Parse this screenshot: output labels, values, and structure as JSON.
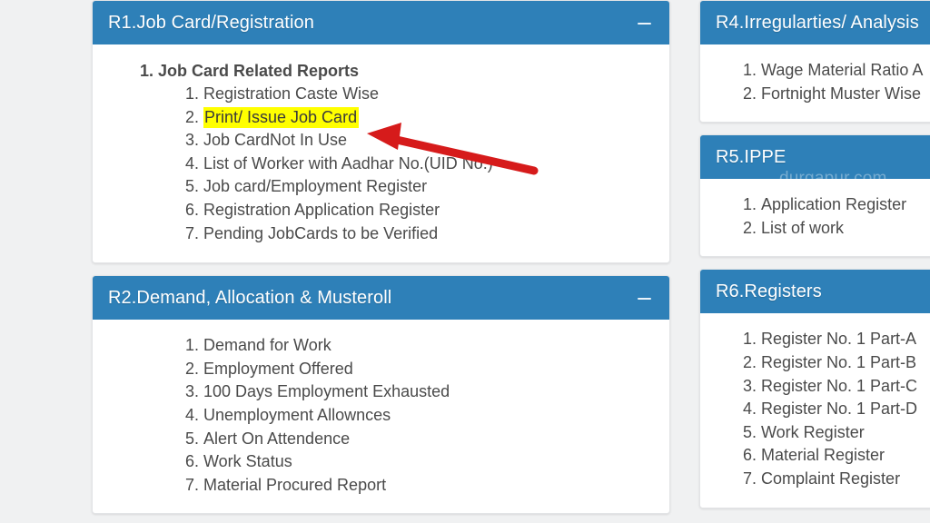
{
  "page": {
    "background_color": "#f0f1f2",
    "panel_header_color": "#2e80b8",
    "highlight_color": "#ffff00",
    "annotation_arrow_color": "#d61b1b"
  },
  "watermark": {
    "text": "durgapur.com"
  },
  "panels": {
    "r1": {
      "title": "R1.Job Card/Registration",
      "collapse_icon": "minus-icon",
      "group_heading": "Job Card Related Reports",
      "items": [
        "Registration Caste Wise",
        "Print/ Issue Job Card",
        "Job CardNot In Use",
        "List of Worker with Aadhar No.(UID No.)",
        "Job card/Employment Register",
        "Registration Application Register",
        "Pending JobCards to be Verified"
      ],
      "highlighted_item_index": 1
    },
    "r2": {
      "title": "R2.Demand, Allocation & Musteroll",
      "collapse_icon": "minus-icon",
      "items": [
        "Demand for Work",
        "Employment Offered",
        "100 Days Employment Exhausted",
        "Unemployment Allownces",
        "Alert On Attendence",
        "Work Status",
        "Material Procured Report"
      ]
    },
    "r4": {
      "title": "R4.Irregularties/ Analysis",
      "items": [
        "Wage Material Ratio A",
        "Fortnight Muster Wise"
      ]
    },
    "r5": {
      "title": "R5.IPPE",
      "items": [
        "Application Register",
        "List of work"
      ]
    },
    "r6": {
      "title": "R6.Registers",
      "items": [
        "Register No. 1 Part-A",
        "Register No. 1 Part-B",
        "Register No. 1 Part-C",
        "Register No. 1 Part-D",
        "Work Register",
        "Material Register",
        "Complaint Register"
      ]
    }
  }
}
